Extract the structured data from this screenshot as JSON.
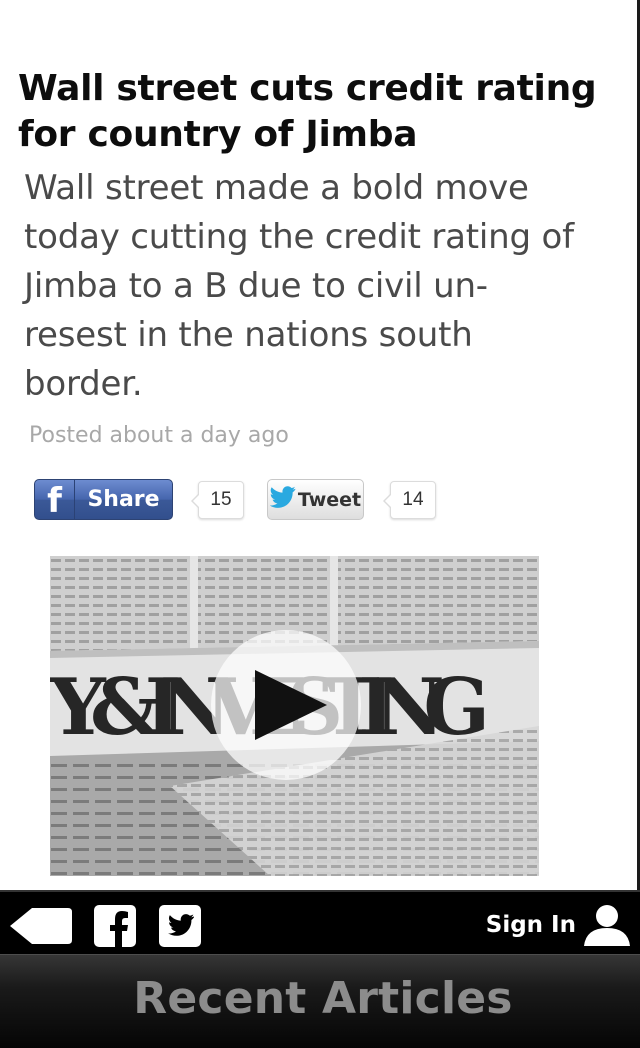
{
  "article": {
    "headline": "Wall street cuts credit rating for country of Jimba",
    "summary": "Wall street made a bold move today cutting the credit rating of Jimba to a B due to civil un-resest in the nations south border.",
    "posted": "Posted about a day ago"
  },
  "social": {
    "facebook": {
      "label": "Share",
      "count": "15",
      "icon": "facebook-f-icon"
    },
    "twitter": {
      "label": "Tweet",
      "count": "14",
      "icon": "twitter-bird-icon"
    }
  },
  "video": {
    "thumbnail_text": "& INVESTING",
    "thumbnail_prefix": "Y &",
    "thumbnail_word": "INVESTING",
    "play_icon": "play-icon"
  },
  "toolbar": {
    "sign_in_label": "Sign In",
    "icons": [
      "back-icon",
      "facebook-icon",
      "twitter-icon",
      "user-icon"
    ]
  },
  "recent": {
    "title": "Recent Articles"
  },
  "colors": {
    "facebook_blue": "#3b5998",
    "toolbar_bg": "#000000",
    "recent_title": "#8c8c8c",
    "posted_text": "#a8a8a8"
  }
}
